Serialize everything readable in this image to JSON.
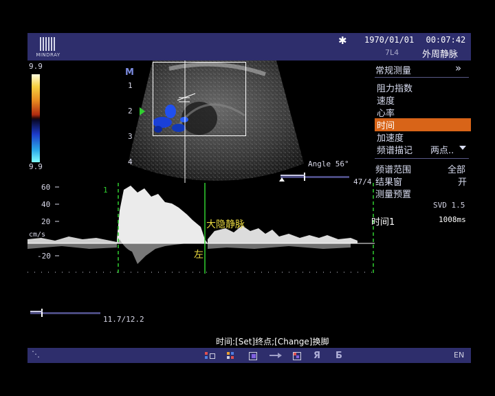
{
  "header": {
    "logo_text": "MINDRAY",
    "date": "1970/01/01",
    "time": "00:07:42",
    "probe": "7L4",
    "exam": "外周静脉"
  },
  "menu": {
    "title": "常规测量",
    "items": [
      "阻力指数",
      "速度",
      "心率",
      "时间",
      "加速度",
      "频谱描记"
    ],
    "selected": "时间",
    "trace_value": "两点..",
    "spectrum_range_label": "频谱范围",
    "spectrum_range_value": "全部",
    "result_window_label": "结果窗",
    "result_window_value": "开",
    "preset_label": "测量预置"
  },
  "svd": "SVD 1.5",
  "result": {
    "label": "时间1",
    "value": "1008ms"
  },
  "velocity_scale": {
    "top": "9.9",
    "bottom": "9.9"
  },
  "depth_marks": [
    "1",
    "2",
    "3",
    "4"
  ],
  "angle": "Angle 56°",
  "depth_readout": "47/4",
  "spectrum": {
    "ticks": [
      "60",
      "40",
      "20",
      "-20"
    ],
    "unit": "cm/s",
    "cursor_label": "1",
    "vessel": "大隐静脉",
    "side": "左"
  },
  "scroll_readout": "11.7/12.2",
  "prompt": "时间:[Set]终点;[Change]换脚",
  "footer": {
    "lang": "EN"
  },
  "colors": {
    "bar": "#2e2e6c",
    "selected": "#d86418",
    "vessel_label": "#e8d840",
    "cursor": "#30d030"
  }
}
